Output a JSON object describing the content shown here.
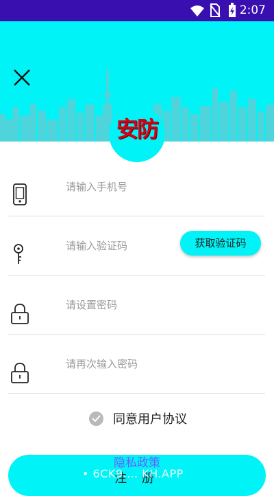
{
  "status_bar": {
    "time": "2:07",
    "icons": [
      "wifi-icon",
      "no-sim-icon",
      "battery-charging-icon"
    ]
  },
  "header": {
    "logo_text": "安防",
    "close_icon": "close-icon"
  },
  "form": {
    "phone": {
      "placeholder": "请输入手机号",
      "icon": "phone-icon"
    },
    "code": {
      "placeholder": "请输入验证码",
      "icon": "key-icon",
      "button_label": "获取验证码"
    },
    "password": {
      "placeholder": "请设置密码",
      "icon": "lock-icon"
    },
    "confirm_password": {
      "placeholder": "请再次输入密码",
      "icon": "lock-icon"
    }
  },
  "agreement": {
    "label": "同意用户协议",
    "checked": true
  },
  "register_button": {
    "label": "注 册"
  },
  "privacy_link": "隐私政策",
  "watermark": "• 6CK9.… KH.APP",
  "colors": {
    "accent": "#00f4f7",
    "status_bar": "#3a0fb0",
    "logo_red": "#d40015",
    "link": "#6a5cff"
  }
}
